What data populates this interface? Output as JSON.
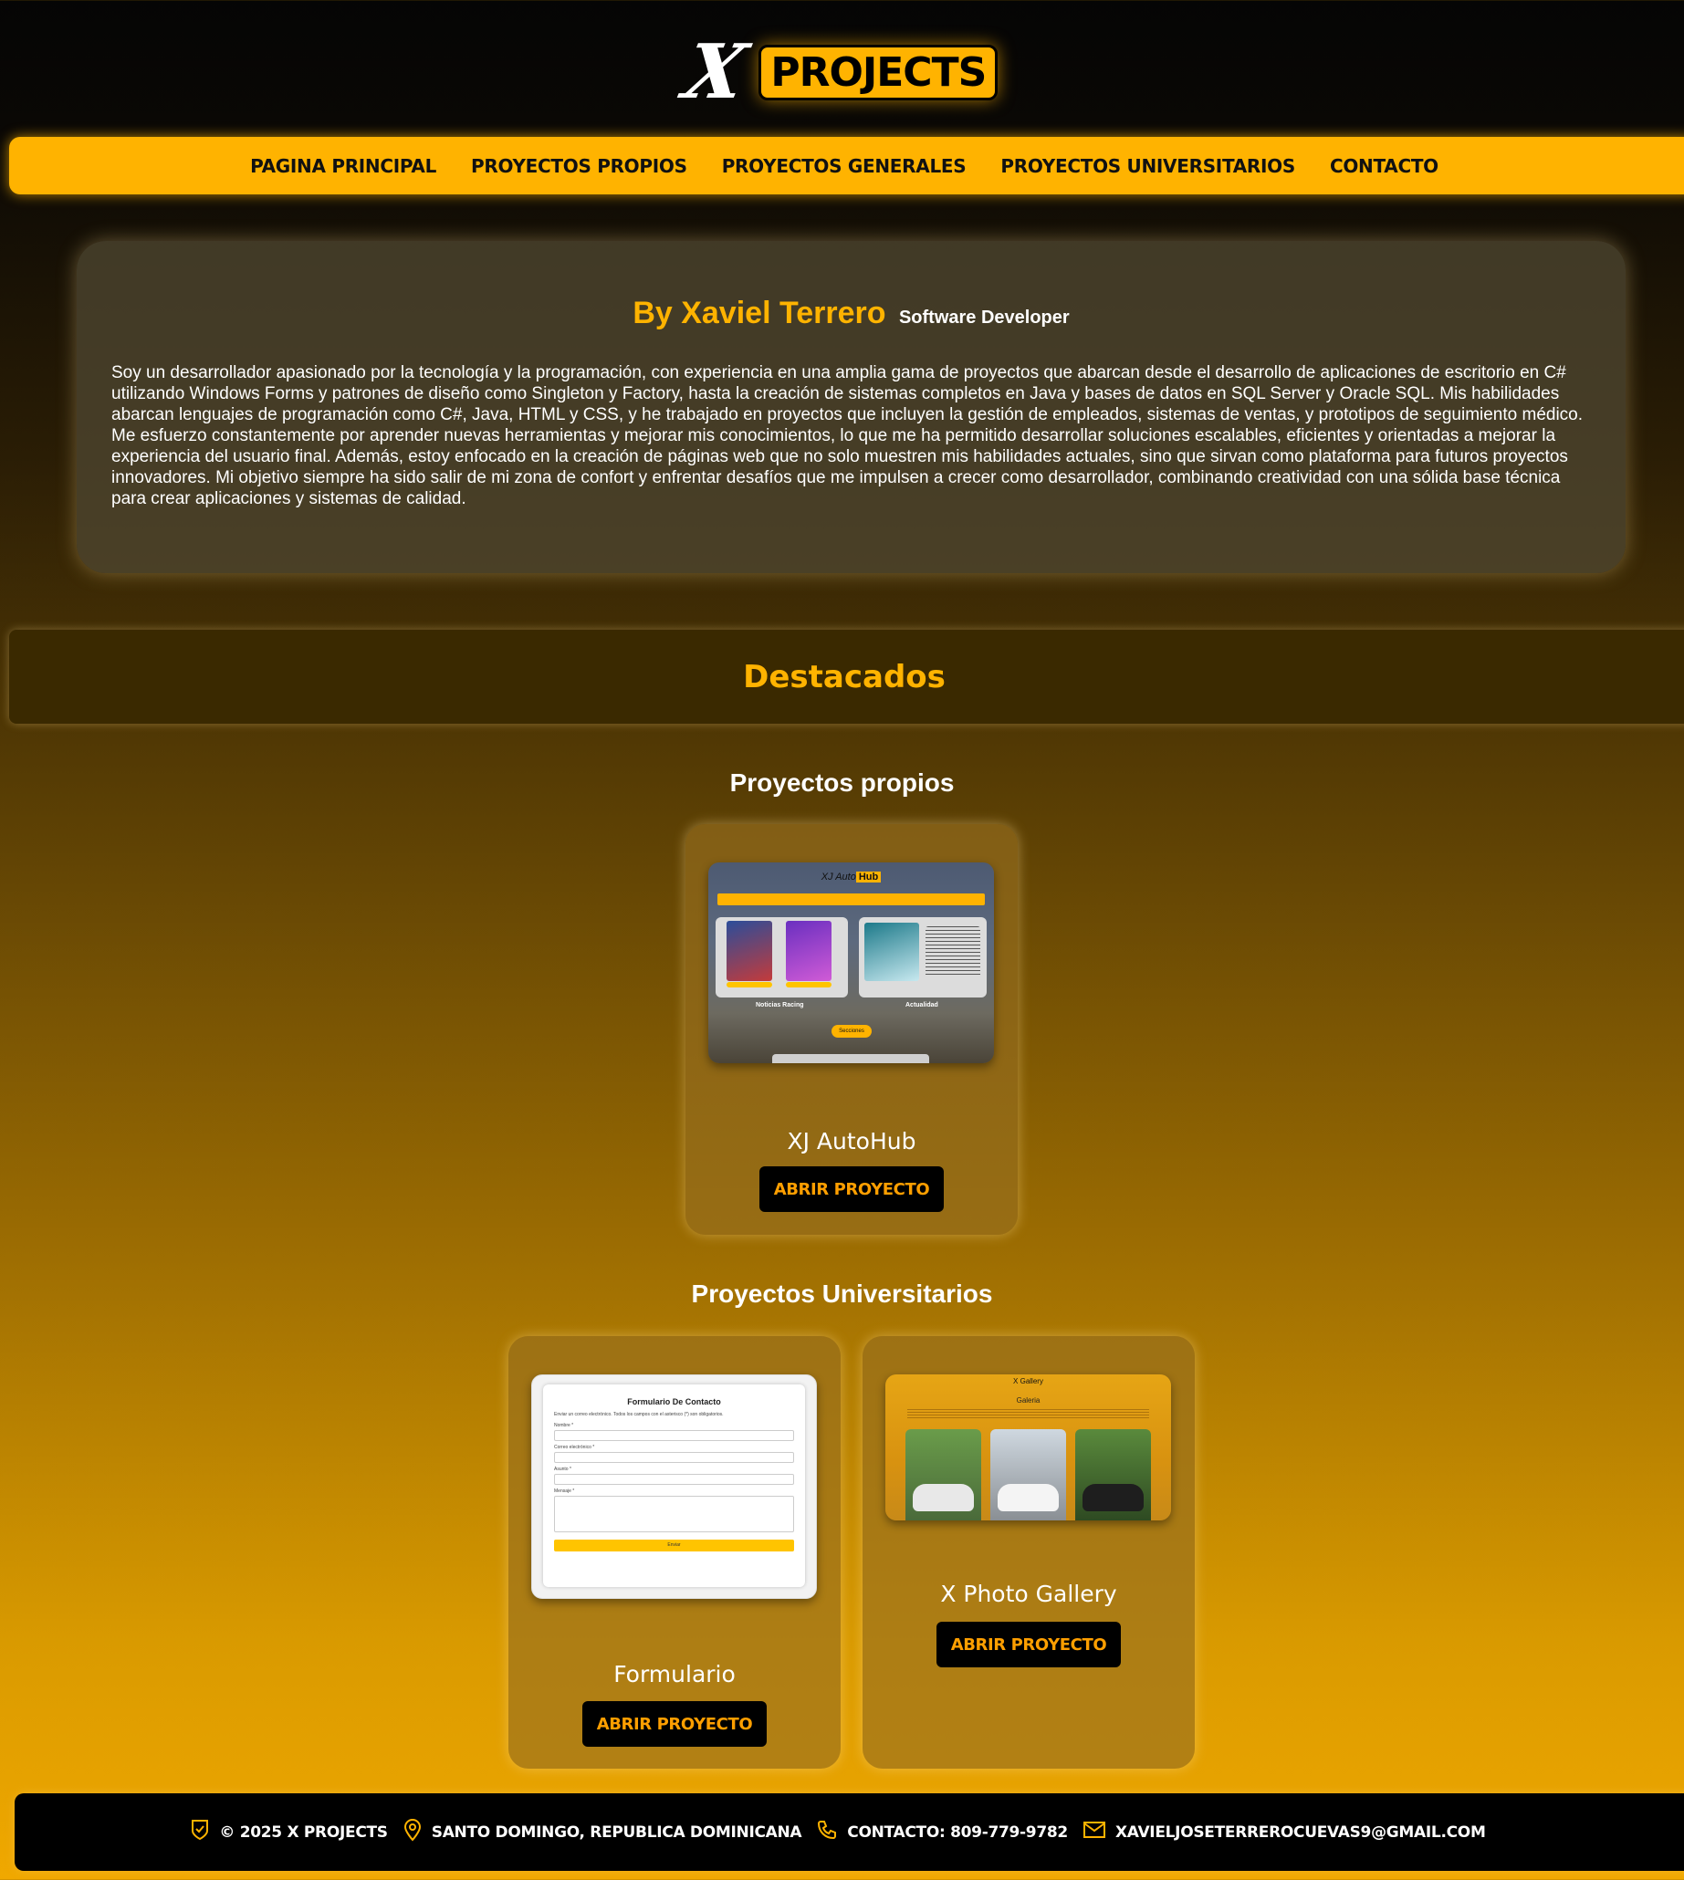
{
  "header": {
    "logo_mark": "X",
    "logo_text": "PROJECTS"
  },
  "nav": {
    "items": [
      {
        "label": "PAGINA PRINCIPAL"
      },
      {
        "label": "PROYECTOS PROPIOS"
      },
      {
        "label": "PROYECTOS GENERALES"
      },
      {
        "label": "PROYECTOS UNIVERSITARIOS"
      },
      {
        "label": "CONTACTO"
      }
    ]
  },
  "about": {
    "name": "By Xaviel Terrero",
    "role": "Software Developer",
    "text": "Soy un desarrollador apasionado por la tecnología y la programación, con experiencia en una amplia gama de proyectos que abarcan desde el desarrollo de aplicaciones de escritorio en C# utilizando Windows Forms y patrones de diseño como Singleton y Factory, hasta la creación de sistemas completos en Java y bases de datos en SQL Server y Oracle SQL. Mis habilidades abarcan lenguajes de programación como C#, Java, HTML y CSS, y he trabajado en proyectos que incluyen la gestión de empleados, sistemas de ventas, y prototipos de seguimiento médico. Me esfuerzo constantemente por aprender nuevas herramientas y mejorar mis conocimientos, lo que me ha permitido desarrollar soluciones escalables, eficientes y orientadas a mejorar la experiencia del usuario final. Además, estoy enfocado en la creación de páginas web que no solo muestren mis habilidades actuales, sino que sirvan como plataforma para futuros proyectos innovadores. Mi objetivo siempre ha sido salir de mi zona de confort y enfrentar desafíos que me impulsen a crecer como desarrollador, combinando creatividad con una sólida base técnica para crear aplicaciones y sistemas de calidad."
  },
  "featured": {
    "title": "Destacados"
  },
  "own_projects": {
    "title": "Proyectos propios",
    "items": [
      {
        "title": "XJ AutoHub",
        "button": "ABRIR PROYECTO",
        "thumb": {
          "brand_prefix": "XJ Auto",
          "brand_hub": "Hub",
          "left_label": "Noticias Racing",
          "right_label": "Actualidad",
          "pill": "Secciones"
        }
      }
    ]
  },
  "uni_projects": {
    "title": "Proyectos Universitarios",
    "items": [
      {
        "title": "Formulario",
        "button": "ABRIR PROYECTO",
        "thumb": {
          "form_title": "Formulario De Contacto",
          "form_sub": "Enviar un correo electrónico. Todos los campos con el asterisco (*) son obligatorios.",
          "f1": "Nombre *",
          "f2": "Correo electrónico *",
          "f3": "Asunto *",
          "f4": "Mensaje *",
          "btn": "Enviar"
        }
      },
      {
        "title": "X Photo Gallery",
        "button": "ABRIR PROYECTO",
        "thumb": {
          "top": "X Gallery",
          "sub": "Galeria"
        }
      }
    ]
  },
  "footer": {
    "copyright": "© 2025 X PROJECTS",
    "location": "SANTO DOMINGO, REPUBLICA DOMINICANA",
    "phone": "CONTACTO: 809-779-9782",
    "email": "XAVIELJOSETERREROCUEVAS9@GMAIL.COM"
  },
  "colors": {
    "accent": "#ffb300",
    "button_text": "#ff9f00"
  }
}
